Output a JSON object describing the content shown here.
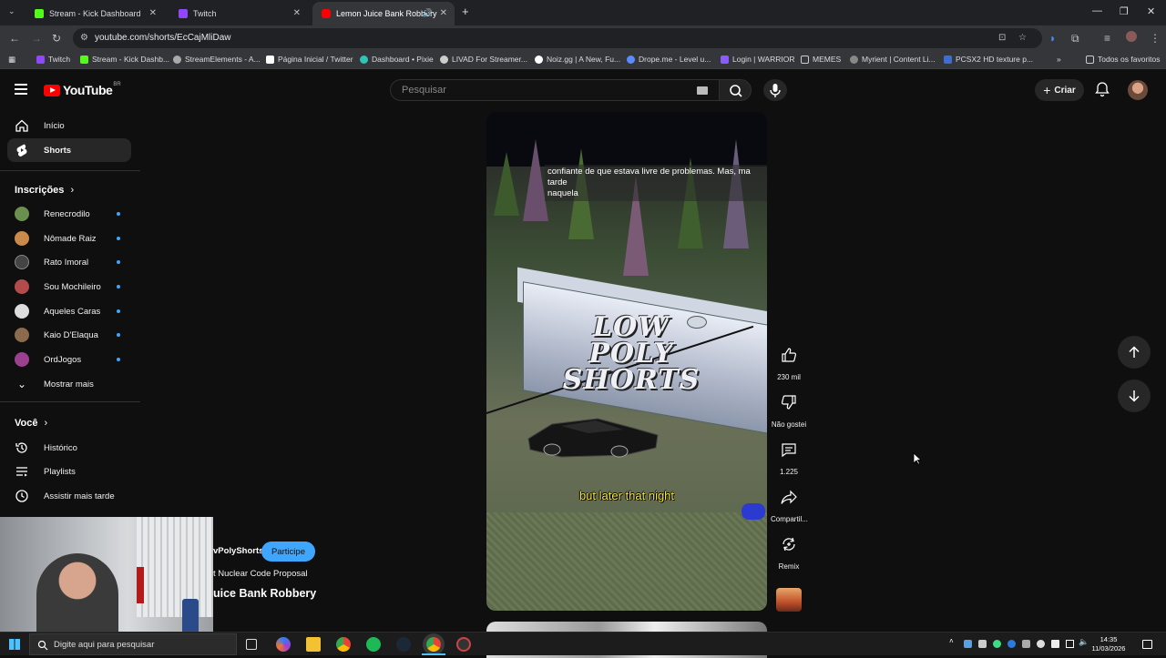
{
  "browser": {
    "tabs": [
      {
        "label": "Stream - Kick Dashboard",
        "color": "#53fc18"
      },
      {
        "label": "Twitch",
        "color": "#9146ff"
      },
      {
        "label": "Lemon Juice Bank Robbery",
        "color": "#ff0000"
      }
    ],
    "url": "youtube.com/shorts/EcCajMliDaw",
    "bookmarks": [
      {
        "label": "Twitch",
        "color": "#9146ff"
      },
      {
        "label": "Stream - Kick Dashb...",
        "color": "#53fc18"
      },
      {
        "label": "StreamElements - A...",
        "color": "#aaaaaa"
      },
      {
        "label": "Página Inicial / Twitter",
        "color": "#ffffff"
      },
      {
        "label": "Dashboard • Pixie",
        "color": "#2ec4b6"
      },
      {
        "label": "LIVAD For Streamer...",
        "color": "#cccccc"
      },
      {
        "label": "Noiz.gg | A New, Fu...",
        "color": "#ffffff"
      },
      {
        "label": "Drope.me - Level u...",
        "color": "#5b8cff"
      },
      {
        "label": "Login | WARRIOR",
        "color": "#8a5cff"
      },
      {
        "label": "MEMES",
        "color": "#cccccc"
      },
      {
        "label": "Myrient | Content Li...",
        "color": "#888888"
      },
      {
        "label": "PCSX2 HD texture p...",
        "color": "#3b6fd6"
      }
    ],
    "all_bookmarks": "Todos os favoritos"
  },
  "youtube": {
    "logo_text": "YouTube",
    "country_code": "BR",
    "search_placeholder": "Pesquisar",
    "create_label": "Criar",
    "sidebar": {
      "main": [
        {
          "label": "Início",
          "icon": "home-icon"
        },
        {
          "label": "Shorts",
          "icon": "shorts-icon"
        }
      ],
      "subscriptions_header": "Inscrições",
      "subscriptions": [
        {
          "label": "Renecrodilo",
          "color": "#6b8f4e"
        },
        {
          "label": "Nômade Raiz",
          "color": "#c98a4b"
        },
        {
          "label": "Rato Imoral",
          "color": "#444444"
        },
        {
          "label": "Sou Mochileiro",
          "color": "#b34b4b"
        },
        {
          "label": "Aqueles Caras",
          "color": "#dddddd"
        },
        {
          "label": "Kaio D'Elaqua",
          "color": "#8b6a4d"
        },
        {
          "label": "OrdJogos",
          "color": "#9b3f8f"
        }
      ],
      "show_more": "Mostrar mais",
      "you_header": "Você",
      "you_items": [
        {
          "label": "Histórico",
          "icon": "history-icon"
        },
        {
          "label": "Playlists",
          "icon": "playlists-icon"
        },
        {
          "label": "Assistir mais tarde",
          "icon": "clock-icon"
        }
      ]
    },
    "short": {
      "caption": "confiante de que estava livre de problemas.  Mas, ma tarde naquela",
      "caption_lines": [
        "confiante de que estava livre de problemas.  Mas, ma",
        "tarde",
        "naquela"
      ],
      "overlay_logo": [
        "LOW",
        "POLY",
        "SHORTS"
      ],
      "subtitle": "but later that night",
      "channel_name": "vPolyShorts",
      "join_label": "Participe",
      "song": "t Nuclear Code Proposal",
      "title": "uice Bank Robbery"
    },
    "actions": [
      {
        "label": "230 mil",
        "icon": "like-icon"
      },
      {
        "label": "Não gostei",
        "icon": "dislike-icon"
      },
      {
        "label": "1.225",
        "icon": "comment-icon"
      },
      {
        "label": "Compartil...",
        "icon": "share-icon"
      },
      {
        "label": "Remix",
        "icon": "remix-icon"
      }
    ]
  },
  "taskbar": {
    "search_placeholder": "Digite aqui para pesquisar",
    "time": "14:35",
    "date": "11/03/2026"
  }
}
